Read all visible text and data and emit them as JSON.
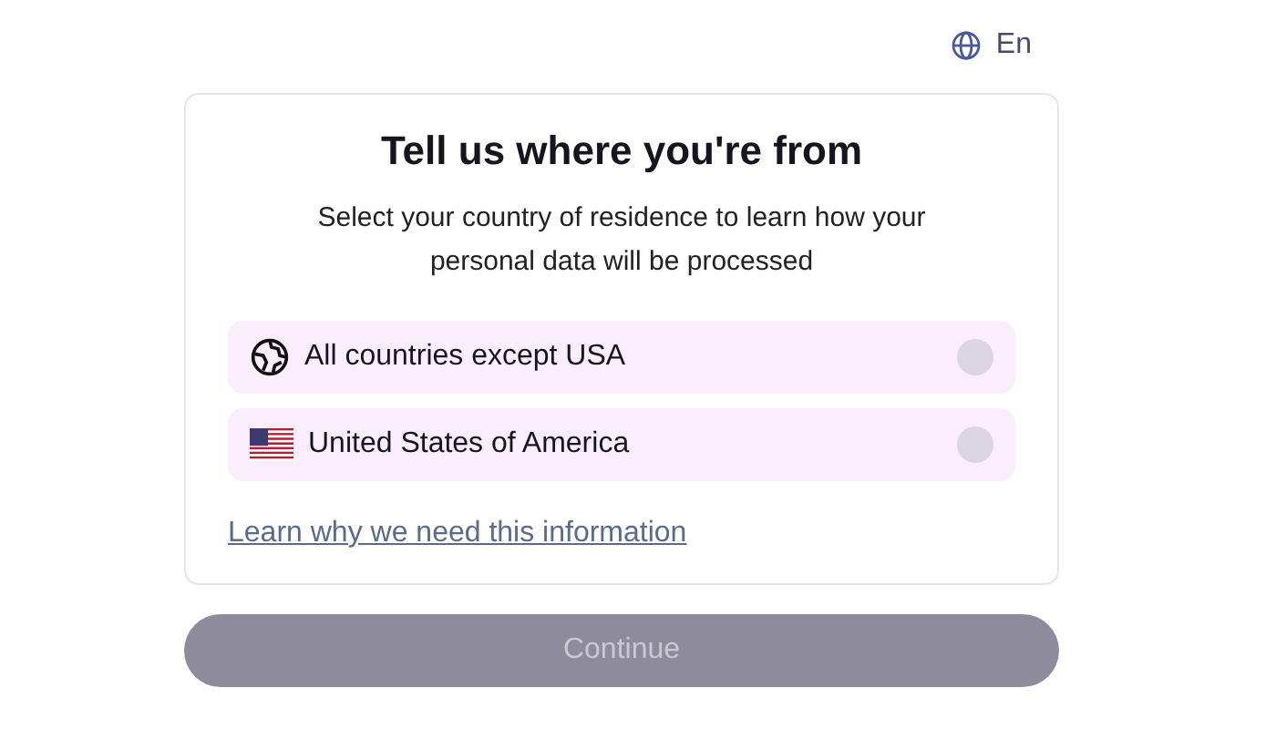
{
  "language": {
    "label": "En"
  },
  "card": {
    "title": "Tell us where you're from",
    "subtitle": "Select your country of residence to learn how your personal data will be processed",
    "options": [
      {
        "kind": "globe",
        "label": "All countries except USA",
        "selected": false
      },
      {
        "kind": "flag",
        "label": "United States of America",
        "selected": false
      }
    ],
    "link": "Learn why we need this information"
  },
  "continue_button": {
    "label": "Continue",
    "disabled": true
  }
}
